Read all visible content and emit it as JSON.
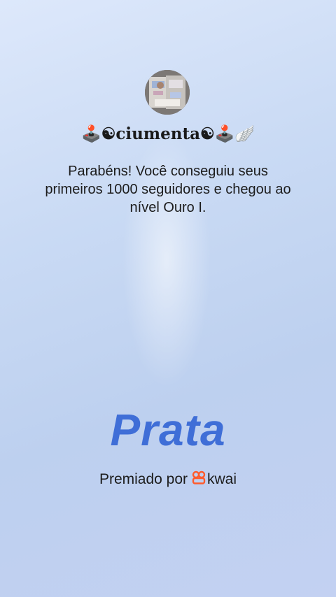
{
  "profile": {
    "username": "🕹️☯ciumenta☯🕹️🪽"
  },
  "achievement": {
    "message": "Parabéns! Você conseguiu seus primeiros 1000 seguidores e chegou ao nível Ouro I.",
    "level_title": "Prata",
    "awarded_by_label": "Premiado por",
    "brand_name": "kwai"
  },
  "colors": {
    "level_title": "#3f6ed7",
    "brand_icon": "#ff5a2b"
  },
  "icons": {
    "brand": "kwai-logo-icon"
  }
}
